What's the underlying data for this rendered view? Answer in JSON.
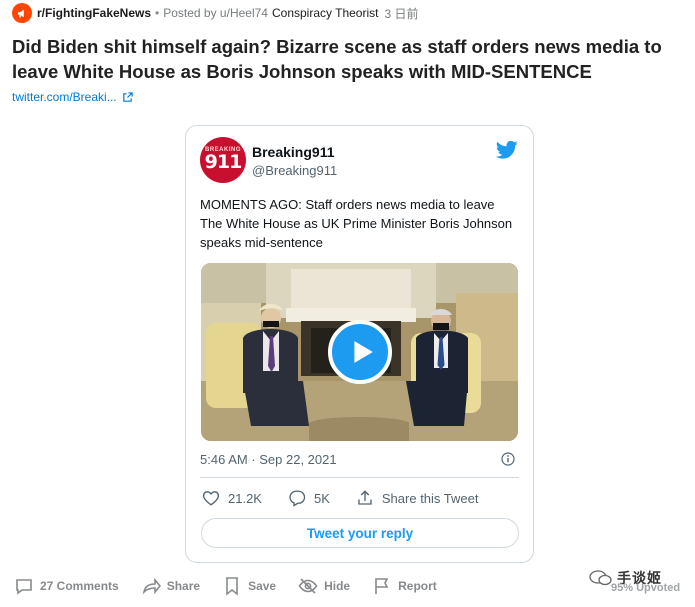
{
  "post": {
    "subreddit": "r/FightingFakeNews",
    "posted_by": "Posted by u/Heel74",
    "flair": "Conspiracy Theorist",
    "age": "3 日前",
    "title": "Did Biden shit himself again? Bizarre scene as staff orders news media to leave White House as Boris Johnson speaks with MID-SENTENCE",
    "link_text": "twitter.com/Breaki..."
  },
  "tweet": {
    "account_name": "Breaking911",
    "account_handle": "@Breaking911",
    "avatar_text_top": "BREAKING",
    "avatar_text_num": "911",
    "text": "MOMENTS AGO: Staff orders news media to leave The White House as UK Prime Minister Boris Johnson speaks mid-sentence",
    "timestamp": "5:46 AM · Sep 22, 2021",
    "likes": "21.2K",
    "replies": "5K",
    "share_label": "Share this Tweet",
    "reply_button": "Tweet your reply",
    "brand_color": "#1d9bf0"
  },
  "footer": {
    "comments": "27 Comments",
    "share": "Share",
    "save": "Save",
    "hide": "Hide",
    "report": "Report",
    "upvoted": "95% Upvoted"
  },
  "watermark": {
    "name": "手谈姬"
  },
  "colors": {
    "subreddit_icon": "#ff4500",
    "link": "#0079d3",
    "muted": "#878a8c"
  }
}
